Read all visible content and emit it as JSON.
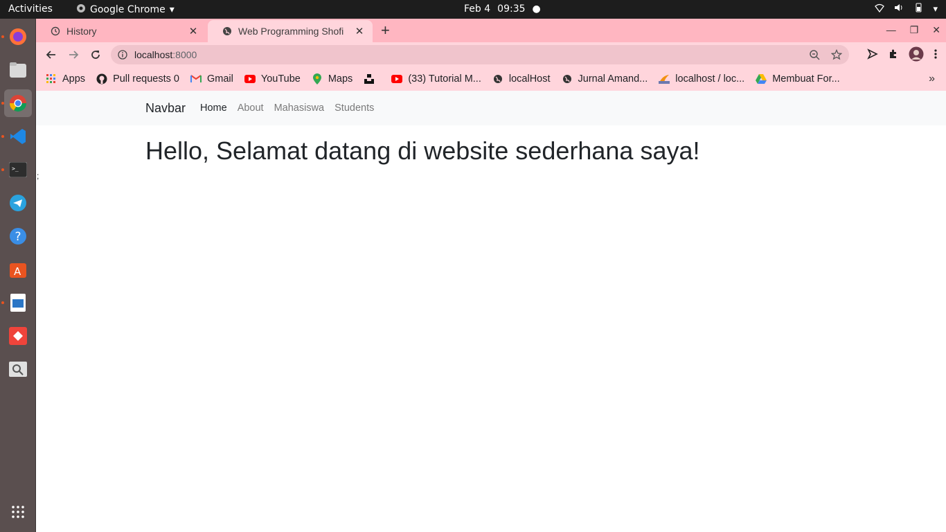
{
  "system": {
    "activities": "Activities",
    "app_name": "Google Chrome",
    "date": "Feb 4",
    "time": "09:35"
  },
  "tabs": [
    {
      "title": "History",
      "icon": "history-icon"
    },
    {
      "title": "Web Programming Shofi",
      "icon": "globe-icon"
    }
  ],
  "address": {
    "host": "localhost",
    "port": ":8000"
  },
  "bookmarks": [
    {
      "label": "Apps",
      "icon": "apps-grid-icon"
    },
    {
      "label": "Pull requests 0",
      "icon": "github-icon"
    },
    {
      "label": "Gmail",
      "icon": "gmail-icon"
    },
    {
      "label": "YouTube",
      "icon": "youtube-icon"
    },
    {
      "label": "Maps",
      "icon": "maps-icon"
    },
    {
      "label": "",
      "icon": "unsplash-icon"
    },
    {
      "label": "(33) Tutorial M...",
      "icon": "youtube-icon"
    },
    {
      "label": "localHost",
      "icon": "globe-icon"
    },
    {
      "label": "Jurnal Amand...",
      "icon": "globe-icon"
    },
    {
      "label": "localhost / loc...",
      "icon": "phpmyadmin-icon"
    },
    {
      "label": "Membuat For...",
      "icon": "drive-icon"
    }
  ],
  "page": {
    "brand": "Navbar",
    "nav": [
      {
        "label": "Home",
        "active": true
      },
      {
        "label": "About",
        "active": false
      },
      {
        "label": "Mahasiswa",
        "active": false
      },
      {
        "label": "Students",
        "active": false
      }
    ],
    "heading": "Hello, Selamat datang di website sederhana saya!",
    "stray_text": ";"
  },
  "colors": {
    "tabstrip": "#ffb6c1",
    "toolbar": "#ffd5dc",
    "omnibox": "#f0c4cc",
    "dock": "#5a4f4f",
    "page_navbar": "#f8f9fa"
  }
}
